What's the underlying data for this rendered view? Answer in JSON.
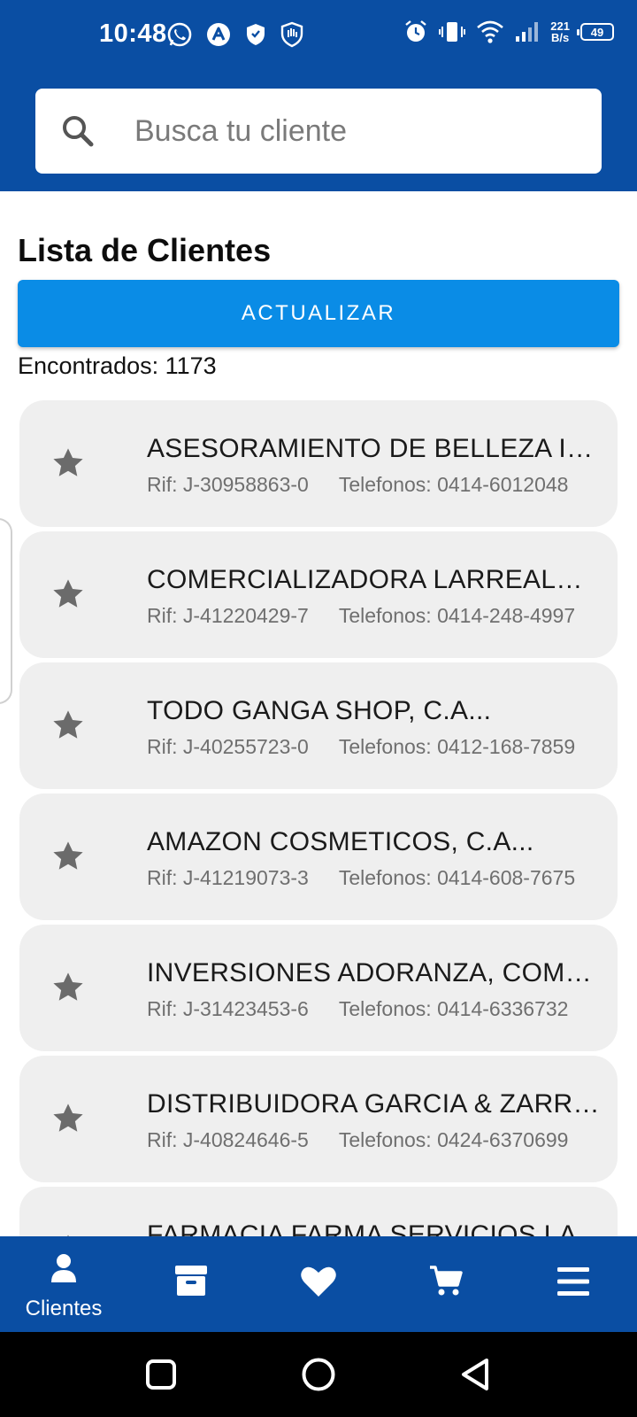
{
  "status_bar": {
    "time": "10:48",
    "net_speed_value": "221",
    "net_speed_unit": "B/s",
    "battery": "49",
    "icons": [
      "whatsapp-icon",
      "app-a-icon",
      "shield-icon",
      "hand-shield-icon",
      "alarm-icon",
      "vibrate-icon",
      "wifi-icon",
      "signal-icon",
      "battery-icon"
    ]
  },
  "search": {
    "placeholder": "Busca tu cliente",
    "value": ""
  },
  "main": {
    "title": "Lista de Clientes",
    "refresh_label": "ACTUALIZAR",
    "found_label": "Encontrados:",
    "found_count": "1173"
  },
  "clients": [
    {
      "name": "ASESORAMIENTO DE BELLEZA IN...",
      "rif": "Rif: J-30958863-0",
      "phone": "Telefonos: 0414-6012048"
    },
    {
      "name": "COMERCIALIZADORA LARREALEZ...",
      "rif": "Rif: J-41220429-7",
      "phone": "Telefonos: 0414-248-4997"
    },
    {
      "name": "TODO GANGA SHOP, C.A...",
      "rif": "Rif: J-40255723-0",
      "phone": "Telefonos: 0412-168-7859"
    },
    {
      "name": "AMAZON COSMETICOS, C.A...",
      "rif": "Rif: J-41219073-3",
      "phone": "Telefonos: 0414-608-7675"
    },
    {
      "name": "INVERSIONES ADORANZA, COMP...",
      "rif": "Rif: J-31423453-6",
      "phone": "Telefonos: 0414-6336732"
    },
    {
      "name": "DISTRIBUIDORA GARCIA & ZARRA...",
      "rif": "Rif: J-40824646-5",
      "phone": "Telefonos: 0424-6370699"
    },
    {
      "name": "FARMACIA FARMA SERVICIOS LA...",
      "rif": "",
      "phone": ""
    }
  ],
  "bottom_nav": {
    "items": [
      {
        "label": "Clientes",
        "icon": "user-icon",
        "active": true
      },
      {
        "label": "",
        "icon": "archive-icon",
        "active": false
      },
      {
        "label": "",
        "icon": "heart-icon",
        "active": false
      },
      {
        "label": "",
        "icon": "cart-icon",
        "active": false
      },
      {
        "label": "",
        "icon": "menu-icon",
        "active": false
      }
    ]
  },
  "colors": {
    "brand": "#0a4ea3",
    "button": "#0a8ce6",
    "card": "#efefef"
  }
}
